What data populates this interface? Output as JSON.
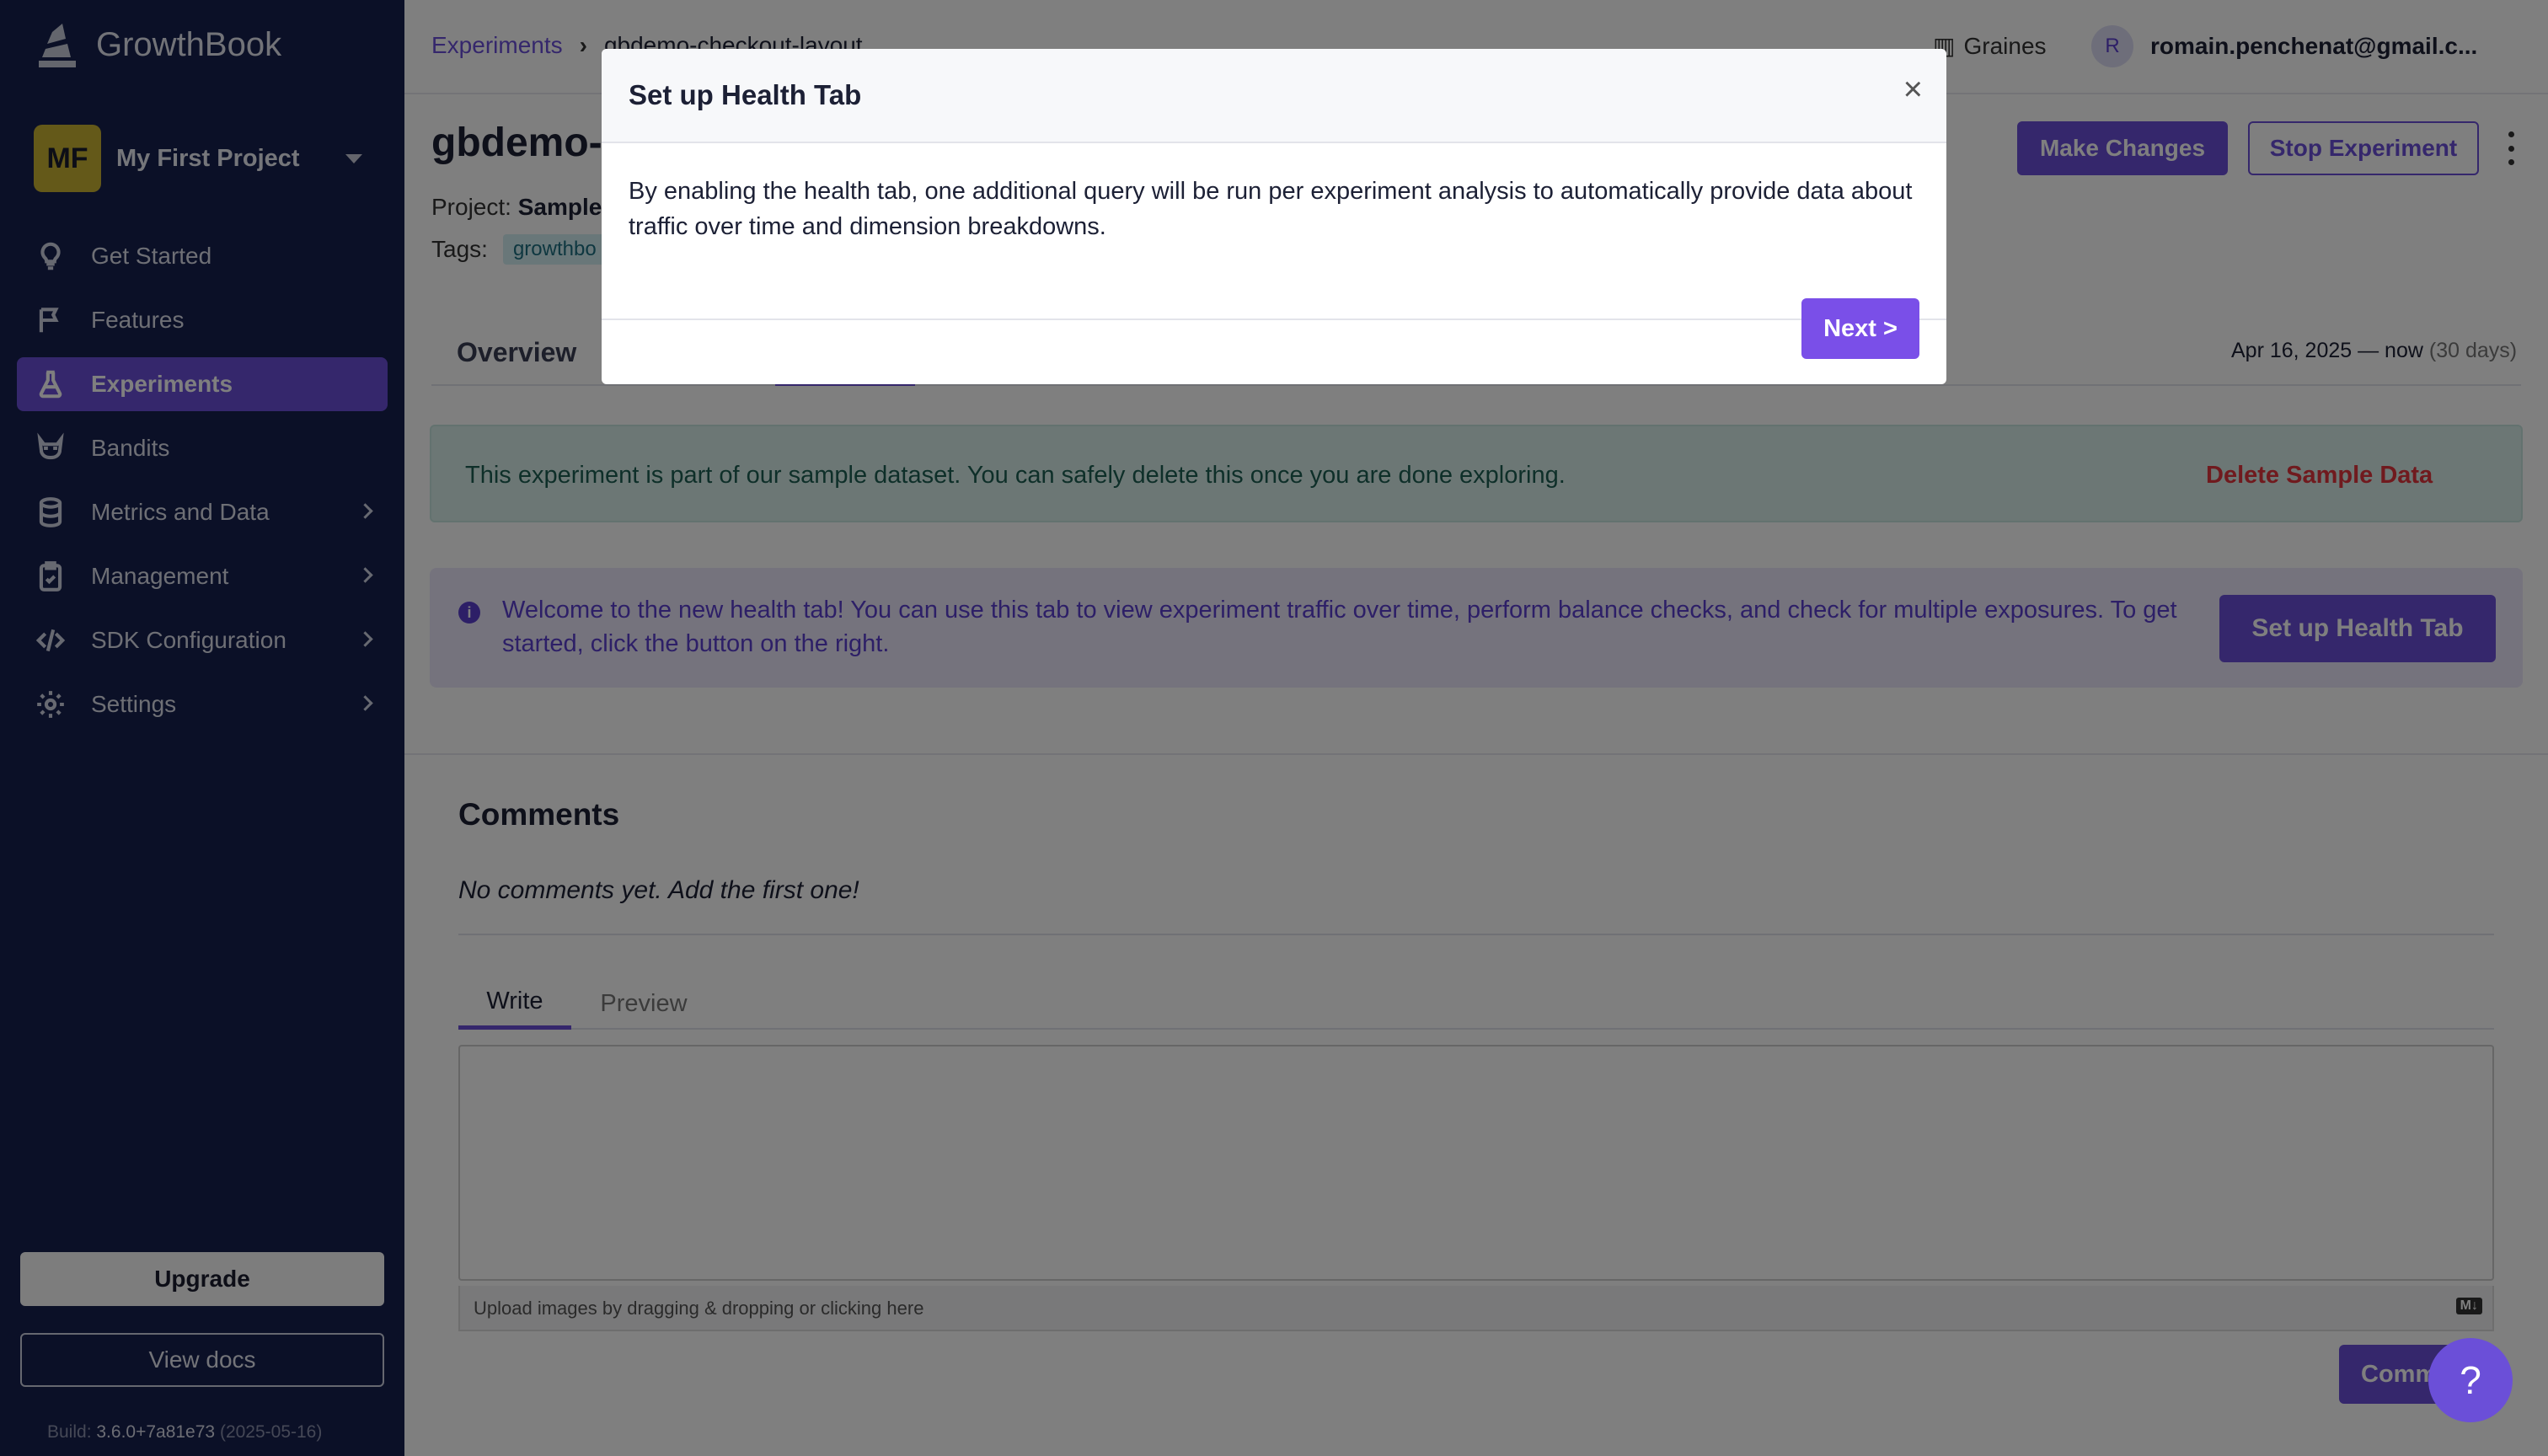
{
  "app": {
    "name": "GrowthBook"
  },
  "project": {
    "initials": "MF",
    "name": "My First Project"
  },
  "nav": [
    {
      "label": "Get Started",
      "icon": "lightbulb-icon"
    },
    {
      "label": "Features",
      "icon": "flag-icon"
    },
    {
      "label": "Experiments",
      "icon": "flask-icon",
      "active": true
    },
    {
      "label": "Bandits",
      "icon": "raccoon-icon"
    },
    {
      "label": "Metrics and Data",
      "icon": "database-icon",
      "expandable": true
    },
    {
      "label": "Management",
      "icon": "clipboard-icon",
      "expandable": true
    },
    {
      "label": "SDK Configuration",
      "icon": "code-icon",
      "expandable": true
    },
    {
      "label": "Settings",
      "icon": "gear-icon",
      "expandable": true
    }
  ],
  "sidebar_footer": {
    "upgrade": "Upgrade",
    "view_docs": "View docs",
    "build_label": "Build:",
    "build_version": "3.6.0+7a81e73",
    "build_date": "(2025-05-16)"
  },
  "topbar": {
    "breadcrumb_root": "Experiments",
    "breadcrumb_current": "gbdemo-checkout-layout",
    "org": "Graines",
    "user_initial": "R",
    "user_email": "romain.penchenat@gmail.c..."
  },
  "experiment": {
    "title_visible": "gbdemo-",
    "project_label": "Project:",
    "project_value": "Sample",
    "tags_label": "Tags:",
    "tag": "growthbo",
    "make_changes": "Make Changes",
    "stop": "Stop Experiment",
    "tab_overview": "Overview",
    "date_range": "Apr 16, 2025 — now",
    "date_days": "(30 days)"
  },
  "sample_alert": {
    "text": "This experiment is part of our sample dataset. You can safely delete this once you are done exploring.",
    "action": "Delete Sample Data"
  },
  "health_banner": {
    "text": "Welcome to the new health tab! You can use this tab to view experiment traffic over time, perform balance checks, and check for multiple exposures. To get started, click the button on the right.",
    "button": "Set up Health Tab"
  },
  "comments": {
    "title": "Comments",
    "empty": "No comments yet. Add the first one!",
    "tab_write": "Write",
    "tab_preview": "Preview",
    "upload_hint": "Upload images by dragging & dropping or clicking here",
    "md_badge": "M↓",
    "submit": "Comment"
  },
  "help": {
    "label": "?"
  },
  "modal": {
    "title": "Set up Health Tab",
    "close": "×",
    "body": "By enabling the health tab, one additional query will be run per experiment analysis to automatically provide data about traffic over time and dimension breakdowns.",
    "next": "Next >"
  },
  "colors": {
    "sidebar": "#16204f",
    "accent": "#6b4fd8",
    "danger": "#e0343c"
  }
}
